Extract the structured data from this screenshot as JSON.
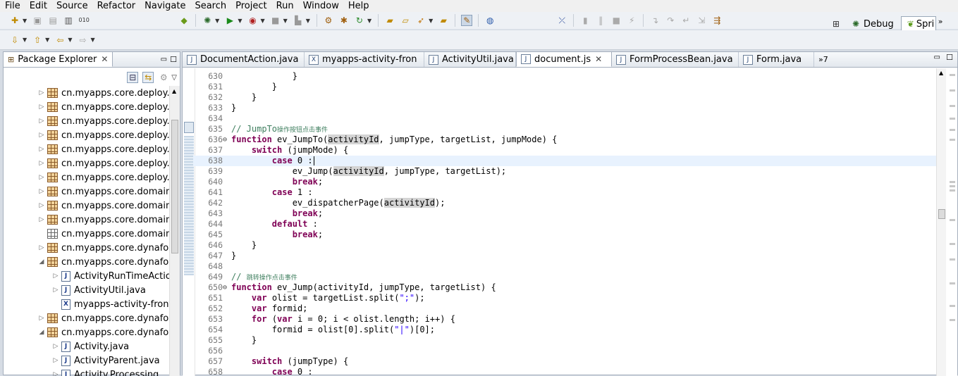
{
  "menu": [
    "File",
    "Edit",
    "Source",
    "Refactor",
    "Navigate",
    "Search",
    "Project",
    "Run",
    "Window",
    "Help"
  ],
  "perspectives": {
    "debug_label": "Debug",
    "spring_label": "Spri",
    "more": "»"
  },
  "package_explorer": {
    "title": "Package Explorer",
    "close": "✕",
    "minimize": "▭",
    "maximize": "☐",
    "items": [
      {
        "label": "cn.myapps.core.deploy.ap",
        "kind": "package",
        "expanded": false,
        "indent": 0
      },
      {
        "label": "cn.myapps.core.deploy.cc",
        "kind": "package",
        "expanded": false,
        "indent": 0
      },
      {
        "label": "cn.myapps.core.deploy.cc",
        "kind": "package",
        "expanded": false,
        "indent": 0
      },
      {
        "label": "cn.myapps.core.deploy.m",
        "kind": "package",
        "expanded": false,
        "indent": 0
      },
      {
        "label": "cn.myapps.core.deploy.m",
        "kind": "package",
        "expanded": false,
        "indent": 0
      },
      {
        "label": "cn.myapps.core.deploy.m",
        "kind": "package",
        "expanded": false,
        "indent": 0
      },
      {
        "label": "cn.myapps.core.deploy.m",
        "kind": "package",
        "expanded": false,
        "indent": 0
      },
      {
        "label": "cn.myapps.core.domain.a",
        "kind": "package",
        "expanded": false,
        "indent": 0
      },
      {
        "label": "cn.myapps.core.domain.d",
        "kind": "package",
        "expanded": false,
        "indent": 0
      },
      {
        "label": "cn.myapps.core.domain.e",
        "kind": "package",
        "expanded": false,
        "indent": 0
      },
      {
        "label": "cn.myapps.core.domain.le",
        "kind": "package-empty",
        "expanded": null,
        "indent": 0
      },
      {
        "label": "cn.myapps.core.dynaform",
        "kind": "package",
        "expanded": false,
        "indent": 0
      },
      {
        "label": "cn.myapps.core.dynaform",
        "kind": "package",
        "expanded": true,
        "indent": 0
      },
      {
        "label": "ActivityRunTimeAction.",
        "kind": "java",
        "expanded": false,
        "indent": 1
      },
      {
        "label": "ActivityUtil.java",
        "kind": "java",
        "expanded": false,
        "indent": 1
      },
      {
        "label": "myapps-activity-front.x",
        "kind": "xml",
        "expanded": null,
        "indent": 1
      },
      {
        "label": "cn.myapps.core.dynaform",
        "kind": "package",
        "expanded": false,
        "indent": 0
      },
      {
        "label": "cn.myapps.core.dynaform",
        "kind": "package",
        "expanded": true,
        "indent": 0
      },
      {
        "label": "Activity.java",
        "kind": "java",
        "expanded": false,
        "indent": 1
      },
      {
        "label": "ActivityParent.java",
        "kind": "java",
        "expanded": false,
        "indent": 1
      },
      {
        "label": "Activity.Processing",
        "kind": "java",
        "expanded": false,
        "indent": 1
      }
    ]
  },
  "editor": {
    "tabs": [
      {
        "label": "DocumentAction.java",
        "icon": "J",
        "active": false
      },
      {
        "label": "myapps-activity-fron",
        "icon": "X",
        "active": false
      },
      {
        "label": "ActivityUtil.java",
        "icon": "J",
        "active": false
      },
      {
        "label": "document.js",
        "icon": "J",
        "active": true
      },
      {
        "label": "FormProcessBean.java",
        "icon": "J",
        "active": false
      },
      {
        "label": "Form.java",
        "icon": "J",
        "active": false
      }
    ],
    "overflow": "»7",
    "close": "✕",
    "lines": [
      {
        "n": "630",
        "fold": "",
        "code": [
          [
            "",
            "            }"
          ]
        ]
      },
      {
        "n": "631",
        "fold": "",
        "code": [
          [
            "",
            "        }"
          ]
        ]
      },
      {
        "n": "632",
        "fold": "",
        "code": [
          [
            "",
            "    }"
          ]
        ]
      },
      {
        "n": "633",
        "fold": "",
        "code": [
          [
            "",
            "}"
          ]
        ]
      },
      {
        "n": "634",
        "fold": "",
        "code": [
          [
            "",
            ""
          ]
        ]
      },
      {
        "n": "635",
        "fold": "",
        "code": [
          [
            "cm",
            "// JumpTo"
          ],
          [
            "cmc",
            "操作按钮点击事件"
          ]
        ]
      },
      {
        "n": "636",
        "fold": "⊖",
        "code": [
          [
            "kw",
            "function"
          ],
          [
            "",
            " ev_JumpTo("
          ],
          [
            "hl",
            "activityId"
          ],
          [
            "",
            ", jumpType, targetList, jumpMode) {"
          ]
        ]
      },
      {
        "n": "637",
        "fold": "",
        "code": [
          [
            "",
            "    "
          ],
          [
            "kw",
            "switch"
          ],
          [
            "",
            " (jumpMode) {"
          ]
        ]
      },
      {
        "n": "638",
        "fold": "",
        "code": [
          [
            "",
            "        "
          ],
          [
            "kw",
            "case"
          ],
          [
            "",
            " 0 :"
          ]
        ],
        "current": true
      },
      {
        "n": "639",
        "fold": "",
        "code": [
          [
            "",
            "            ev_Jump("
          ],
          [
            "hl",
            "activityId"
          ],
          [
            "",
            ", jumpType, targetList);"
          ]
        ]
      },
      {
        "n": "640",
        "fold": "",
        "code": [
          [
            "",
            "            "
          ],
          [
            "kw",
            "break"
          ],
          [
            "",
            ";"
          ]
        ]
      },
      {
        "n": "641",
        "fold": "",
        "code": [
          [
            "",
            "        "
          ],
          [
            "kw",
            "case"
          ],
          [
            "",
            " 1 :"
          ]
        ]
      },
      {
        "n": "642",
        "fold": "",
        "code": [
          [
            "",
            "            ev_dispatcherPage("
          ],
          [
            "hl",
            "activityId"
          ],
          [
            "",
            ");"
          ]
        ]
      },
      {
        "n": "643",
        "fold": "",
        "code": [
          [
            "",
            "            "
          ],
          [
            "kw",
            "break"
          ],
          [
            "",
            ";"
          ]
        ]
      },
      {
        "n": "644",
        "fold": "",
        "code": [
          [
            "",
            "        "
          ],
          [
            "kw",
            "default"
          ],
          [
            "",
            " :"
          ]
        ]
      },
      {
        "n": "645",
        "fold": "",
        "code": [
          [
            "",
            "            "
          ],
          [
            "kw",
            "break"
          ],
          [
            "",
            ";"
          ]
        ]
      },
      {
        "n": "646",
        "fold": "",
        "code": [
          [
            "",
            "    }"
          ]
        ]
      },
      {
        "n": "647",
        "fold": "",
        "code": [
          [
            "",
            "}"
          ]
        ]
      },
      {
        "n": "648",
        "fold": "",
        "code": [
          [
            "",
            ""
          ]
        ]
      },
      {
        "n": "649",
        "fold": "",
        "code": [
          [
            "cm",
            "// "
          ],
          [
            "cmc",
            "跳转操作点击事件"
          ]
        ]
      },
      {
        "n": "650",
        "fold": "⊖",
        "code": [
          [
            "kw",
            "function"
          ],
          [
            "",
            " ev_Jump(activityId, jumpType, targetList) {"
          ]
        ]
      },
      {
        "n": "651",
        "fold": "",
        "code": [
          [
            "",
            "    "
          ],
          [
            "kw",
            "var"
          ],
          [
            "",
            " olist = targetList.split("
          ],
          [
            "st",
            "\";\""
          ],
          [
            "",
            ");"
          ]
        ]
      },
      {
        "n": "652",
        "fold": "",
        "code": [
          [
            "",
            "    "
          ],
          [
            "kw",
            "var"
          ],
          [
            "",
            " formid;"
          ]
        ]
      },
      {
        "n": "653",
        "fold": "",
        "code": [
          [
            "",
            "    "
          ],
          [
            "kw",
            "for"
          ],
          [
            "",
            " ("
          ],
          [
            "kw",
            "var"
          ],
          [
            "",
            " i = 0; i < olist.length; i++) {"
          ]
        ]
      },
      {
        "n": "654",
        "fold": "",
        "code": [
          [
            "",
            "        formid = olist[0].split("
          ],
          [
            "st",
            "\"|\""
          ],
          [
            "",
            ")[0];"
          ]
        ]
      },
      {
        "n": "655",
        "fold": "",
        "code": [
          [
            "",
            "    }"
          ]
        ]
      },
      {
        "n": "656",
        "fold": "",
        "code": [
          [
            "",
            ""
          ]
        ]
      },
      {
        "n": "657",
        "fold": "",
        "code": [
          [
            "",
            "    "
          ],
          [
            "kw",
            "switch"
          ],
          [
            "",
            " (jumpType) {"
          ]
        ]
      },
      {
        "n": "658",
        "fold": "",
        "code": [
          [
            "",
            "        "
          ],
          [
            "kw",
            "case"
          ],
          [
            "",
            " 0 :"
          ]
        ]
      }
    ]
  }
}
